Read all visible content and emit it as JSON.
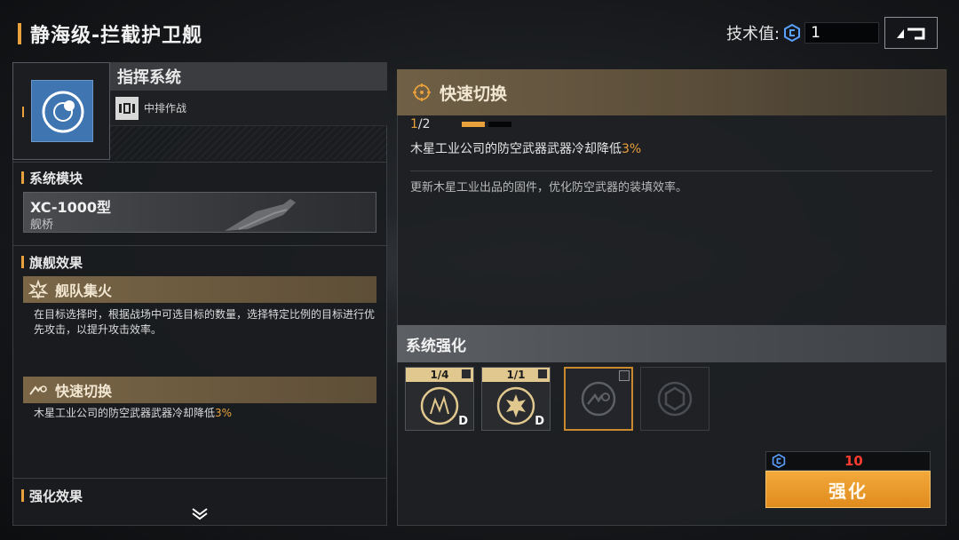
{
  "header": {
    "title": "静海级-拦截护卫舰",
    "tech_label": "技术值:",
    "tech_value": "1"
  },
  "ship": {
    "system_name": "指挥系统",
    "system_tag": "中排作战"
  },
  "system_module": {
    "heading": "系统模块",
    "name": "XC-1000型",
    "type": "舰桥"
  },
  "flagship_effect": {
    "heading": "旗舰效果",
    "effects": [
      {
        "title": "舰队集火",
        "desc": "在目标选择时，根据战场中可选目标的数量，选择特定比例的目标进行优先攻击，以提升攻击效率。"
      },
      {
        "title": "快速切换",
        "desc_prefix": "木星工业公司的防空武器武器冷却降低",
        "desc_value": "3%"
      }
    ]
  },
  "enhancement_effect": {
    "heading": "强化效果"
  },
  "detail": {
    "title": "快速切换",
    "progress_current": "1",
    "progress_total": "/2",
    "progress_fraction": 0.5,
    "line_prefix": "木星工业公司的防空武器武器冷却降低",
    "line_value": "3%",
    "flavor": "更新木星工业出品的固件，优化防空武器的装填效率。"
  },
  "system_enhance": {
    "heading": "系统强化",
    "slots": [
      {
        "count": "1/4",
        "icon": "fleet-signal-icon",
        "state": "unlocked"
      },
      {
        "count": "1/1",
        "icon": "fleet-fire-icon",
        "state": "unlocked"
      },
      {
        "count": "",
        "icon": "quick-switch-icon",
        "state": "selected"
      },
      {
        "count": "",
        "icon": "shield-module-icon",
        "state": "locked"
      }
    ]
  },
  "upgrade": {
    "cost": "10",
    "button_label": "强化"
  },
  "colors": {
    "accent": "#e9a13b",
    "cost": "#ff3b2f",
    "button": "#e08b1d"
  }
}
